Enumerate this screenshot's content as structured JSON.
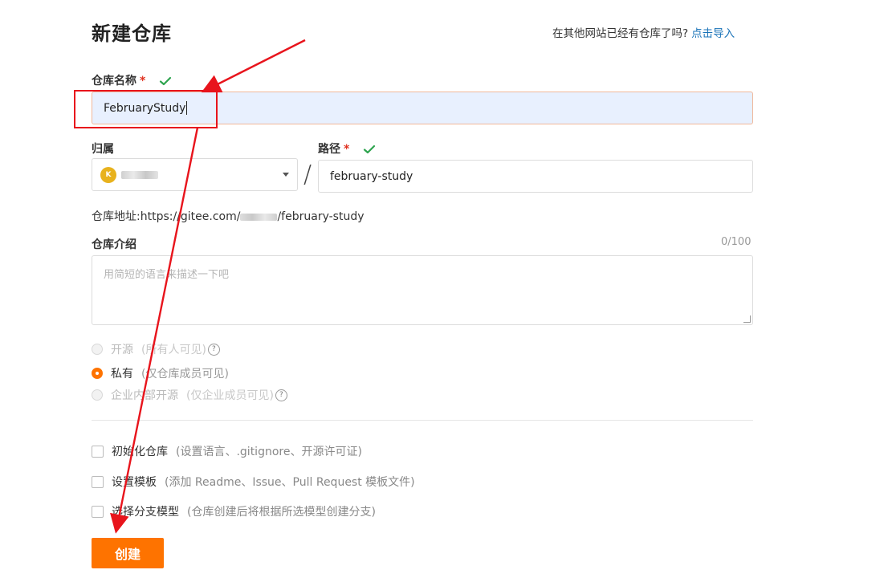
{
  "page": {
    "title": "新建仓库",
    "import_prompt": "在其他网站已经有仓库了吗?",
    "import_link": "点击导入"
  },
  "repo_name": {
    "label": "仓库名称",
    "required_mark": "*",
    "value": "FebruaryStudy"
  },
  "owner": {
    "label": "归属",
    "avatar_letter": "K"
  },
  "separator": "/",
  "path": {
    "label": "路径",
    "required_mark": "*",
    "value": "february-study"
  },
  "address": {
    "label": "仓库地址:",
    "prefix": "https://gitee.com/",
    "suffix": "/february-study"
  },
  "description": {
    "label": "仓库介绍",
    "counter": "0/100",
    "placeholder": "用简短的语言来描述一下吧"
  },
  "visibility": {
    "options": [
      {
        "label": "开源",
        "hint": "(所有人可见)",
        "selected": false,
        "disabled": true
      },
      {
        "label": "私有",
        "hint": "(仅仓库成员可见)",
        "selected": true,
        "disabled": false
      },
      {
        "label": "企业内部开源",
        "hint": "(仅企业成员可见)",
        "selected": false,
        "disabled": true
      }
    ]
  },
  "options": [
    {
      "label": "初始化仓库",
      "hint": "(设置语言、.gitignore、开源许可证)",
      "checked": false
    },
    {
      "label": "设置模板",
      "hint": "(添加 Readme、Issue、Pull Request 模板文件)",
      "checked": false
    },
    {
      "label": "选择分支模型",
      "hint": "(仓库创建后将根据所选模型创建分支)",
      "checked": false
    }
  ],
  "submit": {
    "label": "创建"
  },
  "colors": {
    "accent": "#fe7300",
    "link": "#1a73b8",
    "check": "#2ea44f",
    "annotation": "#e8141c"
  }
}
